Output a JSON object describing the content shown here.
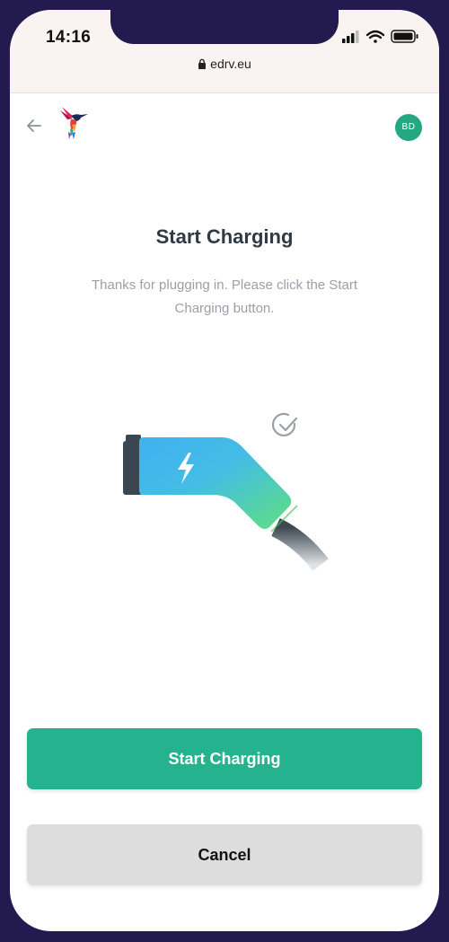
{
  "status_bar": {
    "time": "14:16",
    "url": "edrv.eu",
    "icons": [
      "signal-icon",
      "wifi-icon",
      "battery-icon"
    ]
  },
  "header": {
    "back_icon": "arrow-left-icon",
    "logo": "hummingbird-logo",
    "avatar_initials": "BD"
  },
  "main": {
    "title": "Start Charging",
    "subtitle": "Thanks for plugging in. Please click the Start Charging button.",
    "illustration": "charging-plug-with-check-icon"
  },
  "actions": {
    "start_label": "Start Charging",
    "cancel_label": "Cancel"
  },
  "colors": {
    "background": "#231a4f",
    "primary": "#24b38e",
    "avatar": "#24a882",
    "secondary_button": "#dddddd",
    "title": "#2f3a45",
    "subtitle": "#9aa0a7"
  }
}
